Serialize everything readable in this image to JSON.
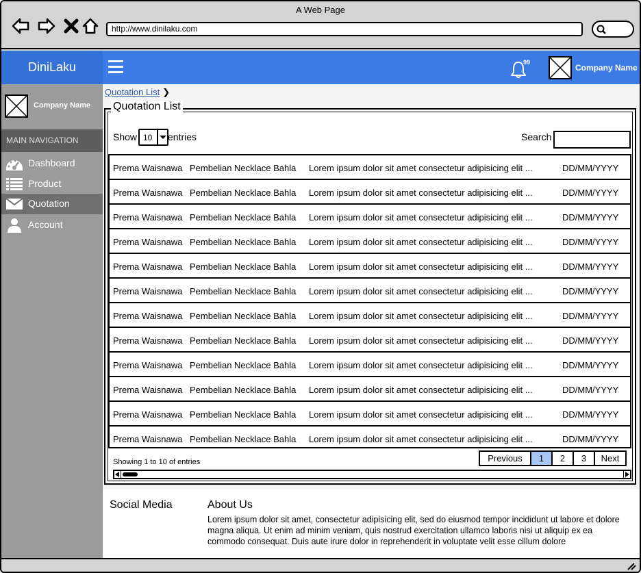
{
  "browser": {
    "title": "A Web Page",
    "url": "http://www.dinilaku.com"
  },
  "header": {
    "brand": "DiniLaku",
    "notification_count": "99",
    "company_name": "Company Name"
  },
  "sidebar": {
    "company_name": "Company Name",
    "nav_heading": "MAIN NAVIGATION",
    "items": [
      {
        "label": "Dashboard",
        "icon": "dashboard-icon"
      },
      {
        "label": "Product",
        "icon": "list-icon"
      },
      {
        "label": "Quotation",
        "icon": "envelope-icon",
        "active": true
      },
      {
        "label": "Account",
        "icon": "user-icon"
      }
    ]
  },
  "breadcrumb": {
    "item": "Quotation List"
  },
  "panel": {
    "title": "Quotation List",
    "show_label": "Show",
    "entries_value": "10",
    "entries_label": "entries",
    "search_label": "Search",
    "search_value": ""
  },
  "table": {
    "rows": [
      [
        "Prema Waisnawa",
        "Pembelian Necklace Bahla",
        "Lorem ipsum dolor sit amet consectetur adipisicing elit ...",
        "DD/MM/YYYY"
      ],
      [
        "Prema Waisnawa",
        "Pembelian Necklace Bahla",
        "Lorem ipsum dolor sit amet consectetur adipisicing elit ...",
        "DD/MM/YYYY"
      ],
      [
        "Prema Waisnawa",
        "Pembelian Necklace Bahla",
        "Lorem ipsum dolor sit amet consectetur adipisicing elit ...",
        "DD/MM/YYYY"
      ],
      [
        "Prema Waisnawa",
        "Pembelian Necklace Bahla",
        "Lorem ipsum dolor sit amet consectetur adipisicing elit ...",
        "DD/MM/YYYY"
      ],
      [
        "Prema Waisnawa",
        "Pembelian Necklace Bahla",
        "Lorem ipsum dolor sit amet consectetur adipisicing elit ...",
        "DD/MM/YYYY"
      ],
      [
        "Prema Waisnawa",
        "Pembelian Necklace Bahla",
        "Lorem ipsum dolor sit amet consectetur adipisicing elit ...",
        "DD/MM/YYYY"
      ],
      [
        "Prema Waisnawa",
        "Pembelian Necklace Bahla",
        "Lorem ipsum dolor sit amet consectetur adipisicing elit ...",
        "DD/MM/YYYY"
      ],
      [
        "Prema Waisnawa",
        "Pembelian Necklace Bahla",
        "Lorem ipsum dolor sit amet consectetur adipisicing elit ...",
        "DD/MM/YYYY"
      ],
      [
        "Prema Waisnawa",
        "Pembelian Necklace Bahla",
        "Lorem ipsum dolor sit amet consectetur adipisicing elit ...",
        "DD/MM/YYYY"
      ],
      [
        "Prema Waisnawa",
        "Pembelian Necklace Bahla",
        "Lorem ipsum dolor sit amet consectetur adipisicing elit ...",
        "DD/MM/YYYY"
      ],
      [
        "Prema Waisnawa",
        "Pembelian Necklace Bahla",
        "Lorem ipsum dolor sit amet consectetur adipisicing elit ...",
        "DD/MM/YYYY"
      ],
      [
        "Prema Waisnawa",
        "Pembelian Necklace Bahla",
        "Lorem ipsum dolor sit amet consectetur adipisicing elit ...",
        "DD/MM/YYYY"
      ]
    ],
    "showing_text": "Showing 1 to 10 of entries"
  },
  "pagination": {
    "previous": "Previous",
    "pages": [
      "1",
      "2",
      "3"
    ],
    "active_page": "1",
    "next": "Next"
  },
  "footer": {
    "social_title": "Social Media",
    "social_icons": [
      "instagram-icon",
      "facebook-icon",
      "youtube-icon"
    ],
    "about_title": "About Us",
    "about_text": "Lorem ipsum dolor sit amet, consectetur adipisicing elit, sed do eiusmod tempor incididunt ut labore et dolore magna aliqua. Ut enim ad minim veniam, quis nostrud exercitation ullamco laboris nisi ut aliquip ex ea commodo consequat. Duis aute irure dolor in reprehenderit in voluptate velit esse cillum dolore"
  },
  "colors": {
    "header_blue": "#3b7be3",
    "brand_blue": "#3572d8",
    "sidebar_gray": "#9b9b9b",
    "nav_heading_bg": "#5d5d5d",
    "active_page": "#a9c7f5"
  }
}
